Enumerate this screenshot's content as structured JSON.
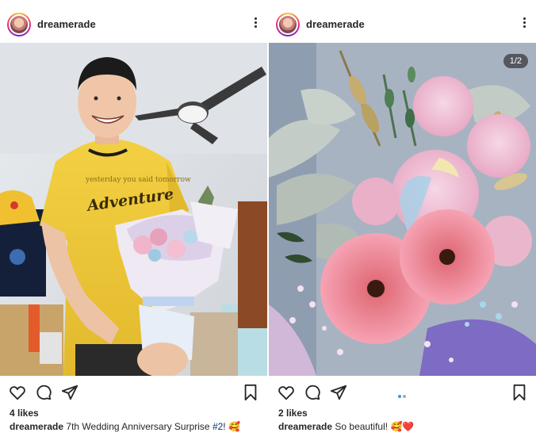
{
  "posts": [
    {
      "username": "dreamerade",
      "likes": "4 likes",
      "caption_user": "dreamerade",
      "caption_text": "7th Wedding Anniversary Surprise ",
      "caption_tag": "#2",
      "caption_suffix": "!",
      "caption_emoji": "🥰",
      "shirt_text_top": "yesterday you said tomorrow",
      "shirt_text_main": "Adventure"
    },
    {
      "username": "dreamerade",
      "likes": "2 likes",
      "caption_user": "dreamerade",
      "caption_text": "So beautiful!",
      "caption_emoji": "🥰❤️",
      "carousel_counter": "1/2",
      "carousel_index": 1,
      "carousel_total": 2
    }
  ],
  "colors": {
    "text": "#262626",
    "hashtag": "#00376b",
    "dot_active": "#3897f0",
    "dot_inactive": "#a8a8a8"
  },
  "icons": [
    "heart-icon",
    "comment-icon",
    "share-icon",
    "bookmark-icon",
    "more-options-icon"
  ]
}
